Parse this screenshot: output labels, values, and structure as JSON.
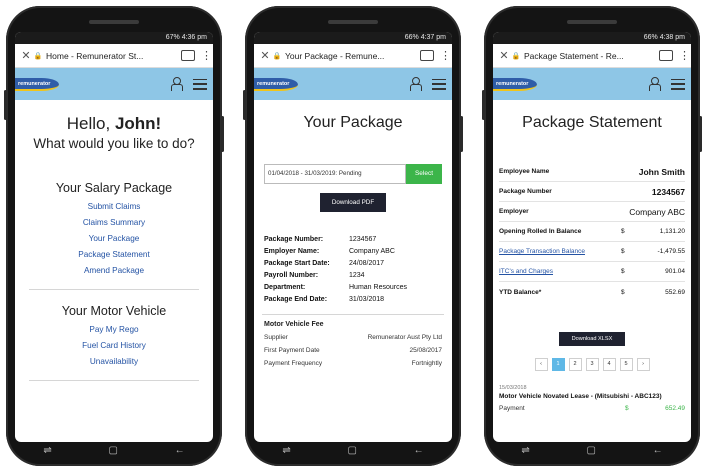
{
  "phone1": {
    "status": "67% 4:36 pm",
    "tab_title": "Home - Remunerator St...",
    "logo_text": "remunerator",
    "greeting_prefix": "Hello, ",
    "greeting_name": "John!",
    "question": "What would you like to do?",
    "salary_section": {
      "title": "Your Salary Package",
      "links": [
        "Submit Claims",
        "Claims Summary",
        "Your Package",
        "Package Statement",
        "Amend Package"
      ]
    },
    "motor_section": {
      "title": "Your Motor Vehicle",
      "links": [
        "Pay My Rego",
        "Fuel Card History",
        "Unavailability"
      ]
    }
  },
  "phone2": {
    "status": "66% 4:37 pm",
    "tab_title": "Your Package - Remune...",
    "logo_text": "remunerator",
    "page_title": "Your Package",
    "period_select": "01/04/2018 - 31/03/2019: Pending",
    "select_button": "Select",
    "download_pdf": "Download PDF",
    "details": [
      {
        "label": "Package Number:",
        "value": "1234567"
      },
      {
        "label": "Employer Name:",
        "value": "Company ABC"
      },
      {
        "label": "Package Start Date:",
        "value": "24/08/2017"
      },
      {
        "label": "Payroll Number:",
        "value": "1234"
      },
      {
        "label": "Department:",
        "value": "Human Resources"
      },
      {
        "label": "Package End Date:",
        "value": "31/03/2018"
      }
    ],
    "fee_box": {
      "title": "Motor Vehicle Fee",
      "rows": [
        {
          "label": "Supplier",
          "value": "Remunerator Aust Pty Ltd"
        },
        {
          "label": "First Payment Date",
          "value": "25/08/2017"
        },
        {
          "label": "Payment Frequency",
          "value": "Fortnightly"
        }
      ]
    }
  },
  "phone3": {
    "status": "66% 4:38 pm",
    "tab_title": "Package Statement - Re...",
    "logo_text": "remunerator",
    "page_title": "Package Statement",
    "info": [
      {
        "label": "Employee Name",
        "value": "John Smith"
      },
      {
        "label": "Package Number",
        "value": "1234567"
      },
      {
        "label": "Employer",
        "value": "Company ABC"
      }
    ],
    "balances": [
      {
        "label": "Opening Rolled In Balance",
        "currency": "$",
        "value": "1,131.20",
        "link": false
      },
      {
        "label": "Package Transaction Balance",
        "currency": "$",
        "value": "-1,479.55",
        "link": true
      },
      {
        "label": "ITC's and Charges",
        "currency": "$",
        "value": "901.04",
        "link": true
      },
      {
        "label": "YTD Balance*",
        "currency": "$",
        "value": "552.69",
        "link": false
      }
    ],
    "download_xlsx": "Download XLSX",
    "pager": [
      "‹",
      "1",
      "2",
      "3",
      "4",
      "5",
      "›"
    ],
    "transaction": {
      "date": "15/03/2018",
      "desc": "Motor Vehicle Novated Lease - (Mitsubishi - ABC123)",
      "label": "Payment",
      "currency": "$",
      "value": "652.49"
    }
  },
  "nav_icons": [
    "recent-apps-icon",
    "home-icon",
    "back-icon"
  ]
}
